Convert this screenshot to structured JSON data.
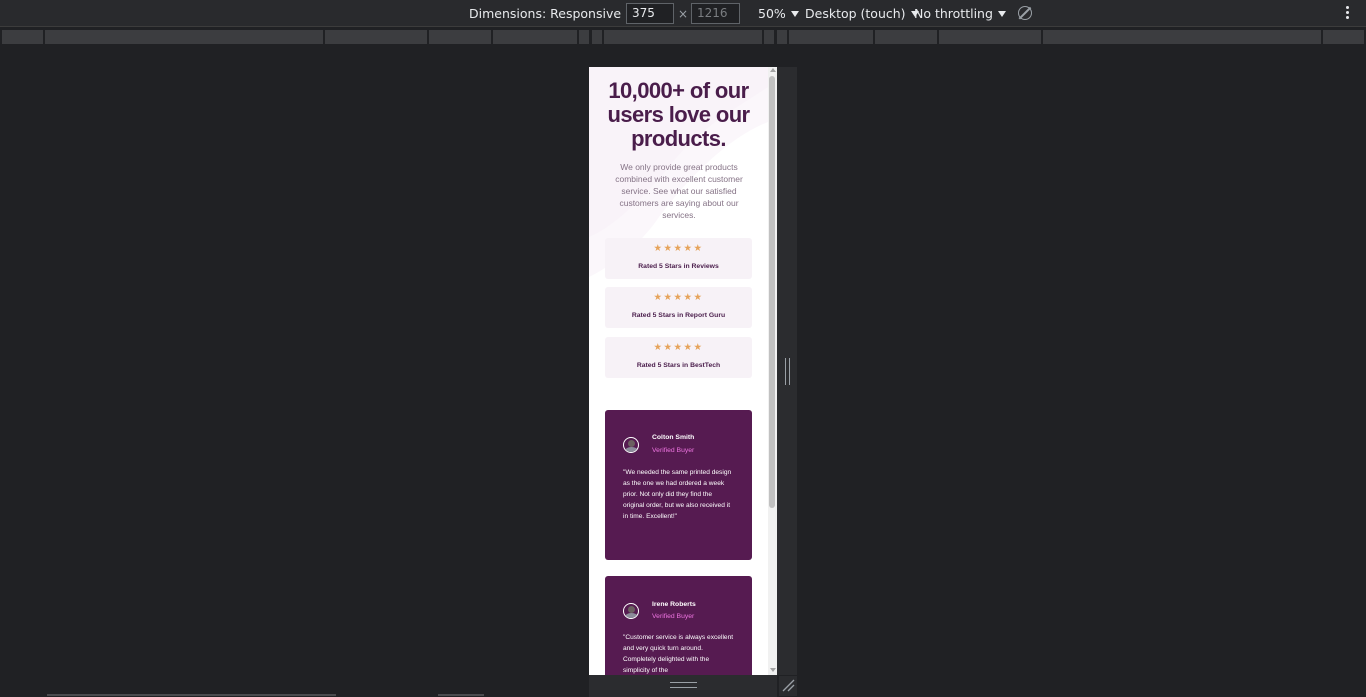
{
  "toolbar": {
    "dimensions_label": "Dimensions: Responsive",
    "width_value": "375",
    "times_sign": "×",
    "height_placeholder": "1216",
    "zoom_label": "50%",
    "device_type_label": "Desktop (touch)",
    "throttling_label": "No throttling",
    "icons": [
      "rotate-icon",
      "more-options-icon"
    ]
  },
  "page": {
    "headline": "10,000+ of our users love our products.",
    "intro": "We only provide great products combined with excellent customer service. See what our satisfied customers are saying about our services.",
    "stars": "★★★★★",
    "ratings": [
      {
        "label": "Rated 5 Stars in Reviews"
      },
      {
        "label": "Rated 5 Stars in Report Guru"
      },
      {
        "label": "Rated 5 Stars in BestTech"
      }
    ],
    "testimonials": [
      {
        "name": "Colton Smith",
        "role": "Verified Buyer",
        "quote": "\"We needed the same printed design as the one we had ordered a week prior. Not only did they find the original order, but we also received it in time. Excellent!\""
      },
      {
        "name": "Irene Roberts",
        "role": "Verified Buyer",
        "quote": "\"Customer service is always excellent and very quick turn around. Completely delighted with the simplicity of the"
      }
    ]
  },
  "colors": {
    "devtools_bg": "#202124",
    "toolbar_bg": "#292a2d",
    "headline": "#4a1d4b",
    "star": "#e6a35a",
    "rating_bg": "#f7f2f7",
    "card_bg": "#561b51",
    "role_pink": "#ee74e1"
  }
}
